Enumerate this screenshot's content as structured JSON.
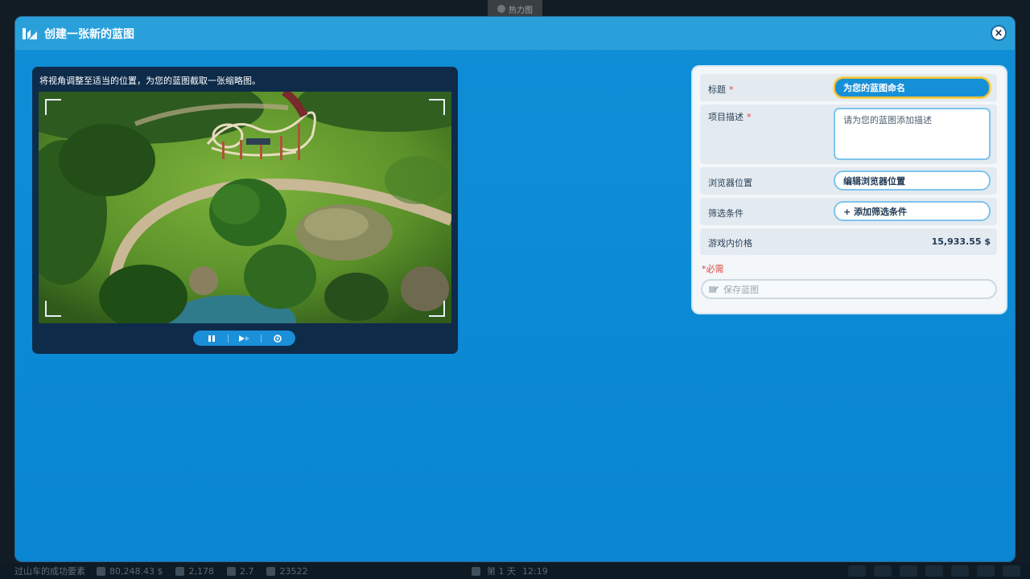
{
  "background": {
    "heatmap_label": "热力图",
    "status_bar": {
      "park_name": "过山车的成功要素",
      "money": "80,248.43 $",
      "guests": "2,178",
      "rating": "2.7",
      "research": "23522",
      "day": "第 1 天",
      "time": "12:19"
    }
  },
  "dialog": {
    "title": "创建一张新的蓝图",
    "close_icon": "close-icon"
  },
  "thumbnail": {
    "instruction": "将视角调整至适当的位置，为您的蓝图截取一张缩略图。",
    "controls": [
      "pause-icon",
      "play-icon",
      "camera-reset-icon"
    ]
  },
  "form": {
    "title_label": "标题",
    "title_value": "为您的蓝图命名",
    "description_label": "项目描述",
    "description_placeholder": "请为您的蓝图添加描述",
    "browser_location_label": "浏览器位置",
    "browser_location_button": "编辑浏览器位置",
    "filter_label": "筛选条件",
    "filter_button": "+ 添加筛选条件",
    "price_label": "游戏内价格",
    "price_value": "15,933.55 $",
    "required_mark": "*",
    "required_note": "*必需",
    "save_button": "保存蓝图"
  },
  "colors": {
    "dialog_bg": "#0a86d2",
    "header_bg": "#2aa0db",
    "required": "#e0443c",
    "focus_border": "#f1c233"
  }
}
